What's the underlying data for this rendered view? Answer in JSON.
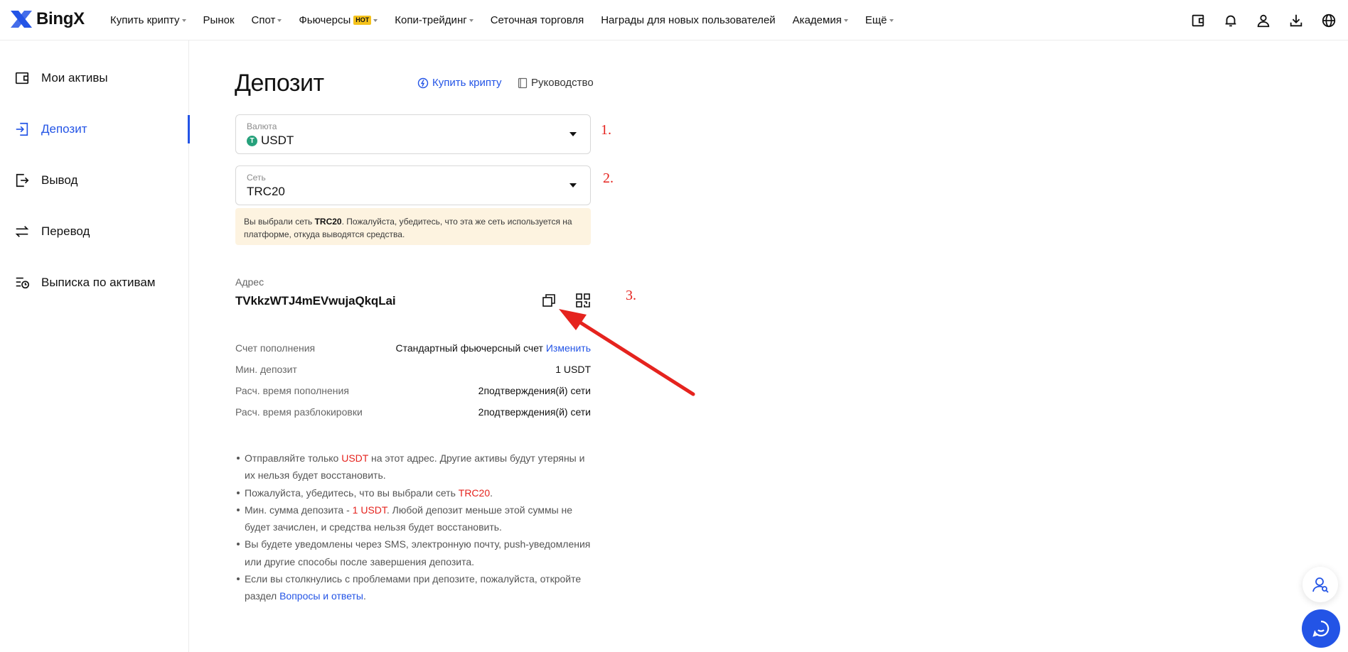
{
  "brand": {
    "name": "BingX",
    "accent": "#2354e6",
    "logo_color": "#2354e6"
  },
  "nav": {
    "items": [
      {
        "label": "Купить крипту",
        "dropdown": true
      },
      {
        "label": "Рынок",
        "dropdown": false
      },
      {
        "label": "Спот",
        "dropdown": true
      },
      {
        "label": "Фьючерсы",
        "dropdown": true,
        "badge": "HOT"
      },
      {
        "label": "Копи-трейдинг",
        "dropdown": true
      },
      {
        "label": "Сеточная торговля",
        "dropdown": false
      },
      {
        "label": "Награды для новых пользователей",
        "dropdown": false
      },
      {
        "label": "Академия",
        "dropdown": true
      },
      {
        "label": "Ещё",
        "dropdown": true
      }
    ],
    "icons": [
      "wallet-icon",
      "bell-icon",
      "user-icon",
      "download-icon",
      "globe-icon"
    ]
  },
  "sidebar": {
    "items": [
      {
        "label": "Мои активы",
        "icon": "wallet-icon",
        "active": false
      },
      {
        "label": "Депозит",
        "icon": "deposit-icon",
        "active": true
      },
      {
        "label": "Вывод",
        "icon": "withdraw-icon",
        "active": false
      },
      {
        "label": "Перевод",
        "icon": "transfer-icon",
        "active": false
      },
      {
        "label": "Выписка по активам",
        "icon": "statement-icon",
        "active": false
      }
    ]
  },
  "main": {
    "title": "Депозит",
    "buy_link": "Купить крипту",
    "guide_link": "Руководство",
    "currency": {
      "label": "Валюта",
      "value": "USDT",
      "coin_symbol": "T"
    },
    "network": {
      "label": "Сеть",
      "value": "TRC20"
    },
    "warning": {
      "prefix": "Вы выбрали сеть ",
      "network": "TRC20",
      "suffix": ". Пожалуйста, убедитесь, что эта же сеть используется на платформе, откуда выводятся средства."
    },
    "address": {
      "label": "Адрес",
      "value": "TVkkzWTJ4mEVwujaQkqLai"
    },
    "details": [
      {
        "label": "Счет пополнения",
        "value": "Стандартный фьючерсный счет",
        "link": "Изменить"
      },
      {
        "label": "Мин. депозит",
        "value": "1 USDT"
      },
      {
        "label": "Расч. время пополнения",
        "value": "2подтверждения(й) сети"
      },
      {
        "label": "Расч. время разблокировки",
        "value": "2подтверждения(й) сети"
      }
    ],
    "notes": {
      "n1": {
        "a": "Отправляйте только ",
        "hl": "USDT",
        "b": " на этот адрес. Другие активы будут утеряны и их нельзя будет восстановить."
      },
      "n2": {
        "a": "Пожалуйста, убедитесь, что вы выбрали сеть ",
        "hl": "TRC20",
        "b": "."
      },
      "n3": {
        "a": "Мин. сумма депозита - ",
        "hl": "1 USDT",
        "b": ". Любой депозит меньше этой суммы не будет зачислен, и средства нельзя будет восстановить."
      },
      "n4": {
        "a": "Вы будете уведомлены через SMS, электронную почту, push-уведомления или другие способы после завершения депозита."
      },
      "n5": {
        "a": "Если вы столкнулись с проблемами при депозите, пожалуйста, откройте раздел ",
        "link": "Вопросы и ответы",
        "b": "."
      }
    }
  },
  "annotations": {
    "mark1": "1.",
    "mark2": "2.",
    "mark3": "3.",
    "color": "#e5231e"
  }
}
